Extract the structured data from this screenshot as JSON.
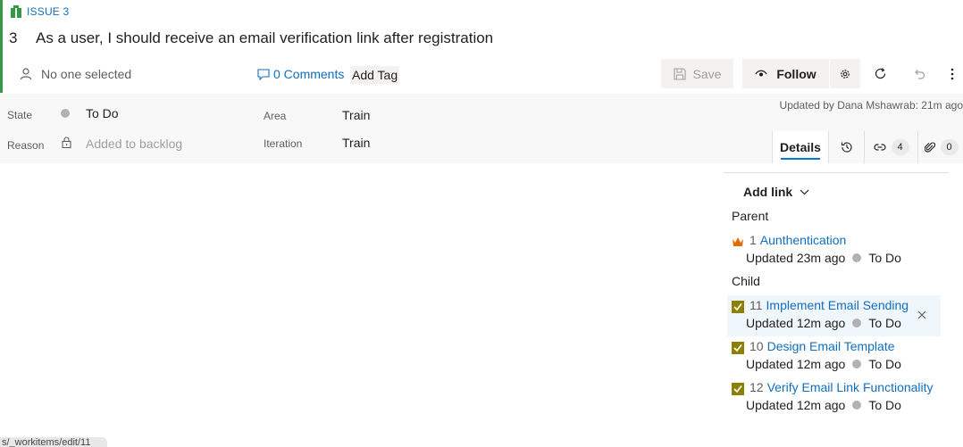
{
  "work_item": {
    "type_label": "ISSUE 3",
    "id": "3",
    "title": "As a user, I should receive an email verification link after registration",
    "assignee": "No one selected",
    "comments": "0 Comments",
    "add_tag": "Add Tag"
  },
  "toolbar": {
    "save_label": "Save",
    "follow_label": "Follow"
  },
  "fields": {
    "state_label": "State",
    "state_value": "To Do",
    "reason_label": "Reason",
    "reason_value": "Added to backlog",
    "area_label": "Area",
    "area_value": "Train",
    "iteration_label": "Iteration",
    "iteration_value": "Train"
  },
  "updated_by": "Updated by Dana Mshawrab: 21m ago",
  "tabs": {
    "details": "Details",
    "links_count": "4",
    "attachments_count": "0"
  },
  "links": {
    "add_link": "Add link",
    "parent_label": "Parent",
    "child_label": "Child",
    "parent": [
      {
        "num": "1",
        "title": "Aunthentication",
        "updated": "Updated 23m ago",
        "state": "To Do"
      }
    ],
    "children": [
      {
        "num": "11",
        "title": "Implement Email Sending",
        "updated": "Updated 12m ago",
        "state": "To Do"
      },
      {
        "num": "10",
        "title": "Design Email Template",
        "updated": "Updated 12m ago",
        "state": "To Do"
      },
      {
        "num": "12",
        "title": "Verify Email Link Functionality",
        "updated": "Updated 12m ago",
        "state": "To Do"
      }
    ]
  },
  "status_url": "s/_workitems/edit/11",
  "colors": {
    "accent": "#339947",
    "link": "#106ebe",
    "task_icon": "#8b8000",
    "epic_icon": "#e06c00",
    "state_dot": "#b2b2b2"
  }
}
